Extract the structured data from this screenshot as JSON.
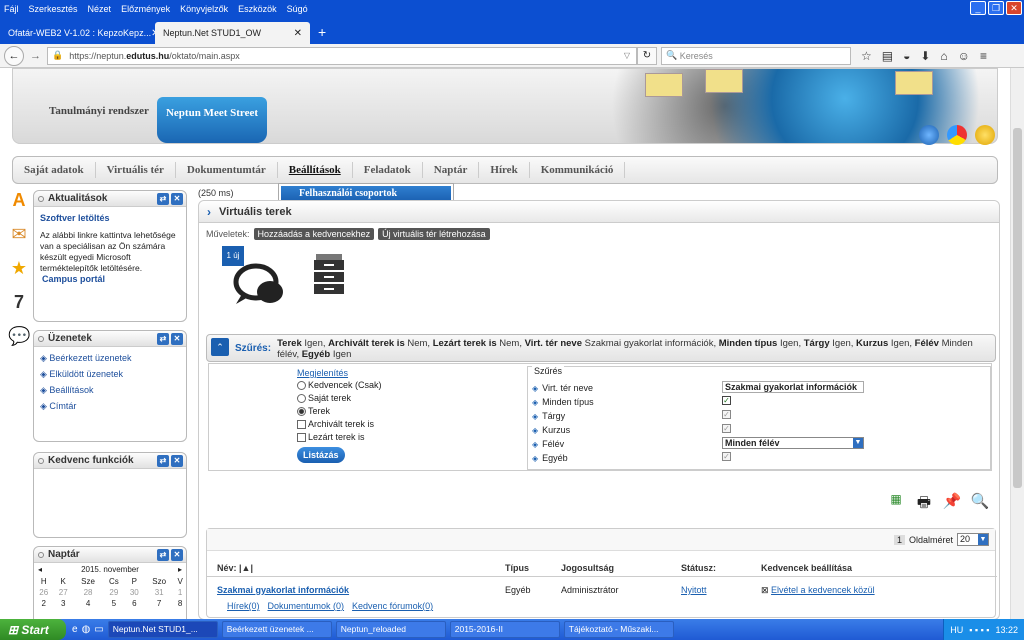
{
  "browser": {
    "menu": [
      "Fájl",
      "Szerkesztés",
      "Nézet",
      "Előzmények",
      "Könyvjelzők",
      "Eszközök",
      "Súgó"
    ],
    "tabs": [
      {
        "label": "Ofatár-WEB2 V-1.02 : KepzoKepz..."
      },
      {
        "label": "Neptun.Net STUD1_OW"
      }
    ],
    "url_prefix": "https://neptun.",
    "url_domain": "edutus.hu",
    "url_path": "/oktato/main.aspx",
    "search_placeholder": "Keresés"
  },
  "header": {
    "system_label": "Tanulmányi rendszer",
    "active_tab": "Neptun Meet Street"
  },
  "nav": {
    "items": [
      "Saját adatok",
      "Virtuális tér",
      "Dokumentumtár",
      "Beállítások",
      "Feladatok",
      "Naptár",
      "Hírek",
      "Kommunikáció"
    ],
    "dropdown_item": "Felhasználói csoportok"
  },
  "portlets": {
    "news": {
      "title": "Aktualitások",
      "item_title": "Szoftver letöltés",
      "text": "Az alábbi linkre kattintva lehetősége van a speciálisan az Ön számára készült egyedi Microsoft terméktelepítők letöltésére.",
      "link": "Campus portál"
    },
    "messages": {
      "title": "Üzenetek",
      "items": [
        "Beérkezett üzenetek",
        "Elküldött üzenetek",
        "Beállítások",
        "Címtár"
      ]
    },
    "favorites": {
      "title": "Kedvenc funkciók"
    },
    "calendar": {
      "title": "Naptár",
      "month": "2015. november",
      "days": [
        "H",
        "K",
        "Sze",
        "Cs",
        "P",
        "Szo",
        "V"
      ],
      "week1": [
        "26",
        "27",
        "28",
        "29",
        "30",
        "31",
        "1"
      ],
      "week2": [
        "2",
        "3",
        "4",
        "5",
        "6",
        "7",
        "8"
      ]
    }
  },
  "main": {
    "timing": "(250 ms)",
    "title": "Virtuális terek",
    "actions_label": "Műveletek:",
    "action1": "Hozzáadás a kedvencekhez",
    "action2": "Új virtuális tér létrehozása",
    "new_badge": "1 új"
  },
  "filter": {
    "label": "Szűrés:",
    "summary_parts": [
      {
        "k": "Terek",
        "v": "Igen, "
      },
      {
        "k": "Archivált terek is",
        "v": "Nem, "
      },
      {
        "k": "Lezárt terek is",
        "v": "Nem, "
      },
      {
        "k": "Virt. tér neve",
        "v": "Szakmai gyakorlat információk, "
      },
      {
        "k": "Minden típus",
        "v": "Igen, "
      },
      {
        "k": "Tárgy",
        "v": "Igen, "
      },
      {
        "k": "Kurzus",
        "v": "Igen, "
      },
      {
        "k": "Félév",
        "v": "Minden félév, "
      },
      {
        "k": "Egyéb",
        "v": "Igen"
      }
    ],
    "display_legend": "Megjelenítés",
    "options": [
      "Kedvencek (Csak)",
      "Saját terek",
      "Terek"
    ],
    "checks": [
      "Archivált terek is",
      "Lezárt terek is"
    ],
    "list_button": "Listázás",
    "criteria_legend": "Szűrés",
    "criteria": [
      "Virt. tér neve",
      "Minden típus",
      "Tárgy",
      "Kurzus",
      "Félév",
      "Egyéb"
    ],
    "name_value": "Szakmai gyakorlat információk",
    "semester_value": "Minden félév"
  },
  "grid": {
    "page_num": "1",
    "page_size_label": "Oldalméret",
    "page_size": "20",
    "headers": [
      "Név:",
      "Típus",
      "Jogosultság",
      "Státusz:",
      "Kedvencek beállítása"
    ],
    "row": {
      "name": "Szakmai gyakorlat információk",
      "type": "Egyéb",
      "permission": "Adminisztrátor",
      "status": "Nyitott",
      "favorite": "Elvétel a kedvencek közül"
    },
    "sublinks": [
      "Hírek(0)",
      "Dokumentumok (0)",
      "Kedvenc fórumok(0)"
    ]
  },
  "taskbar": {
    "start": "Start",
    "tasks": [
      "Neptun.Net STUD1_...",
      "Beérkezett üzenetek ...",
      "Neptun_reloaded",
      "2015-2016-II",
      "Tájékoztató - Műszaki..."
    ],
    "lang": "HU",
    "time": "13:22"
  }
}
